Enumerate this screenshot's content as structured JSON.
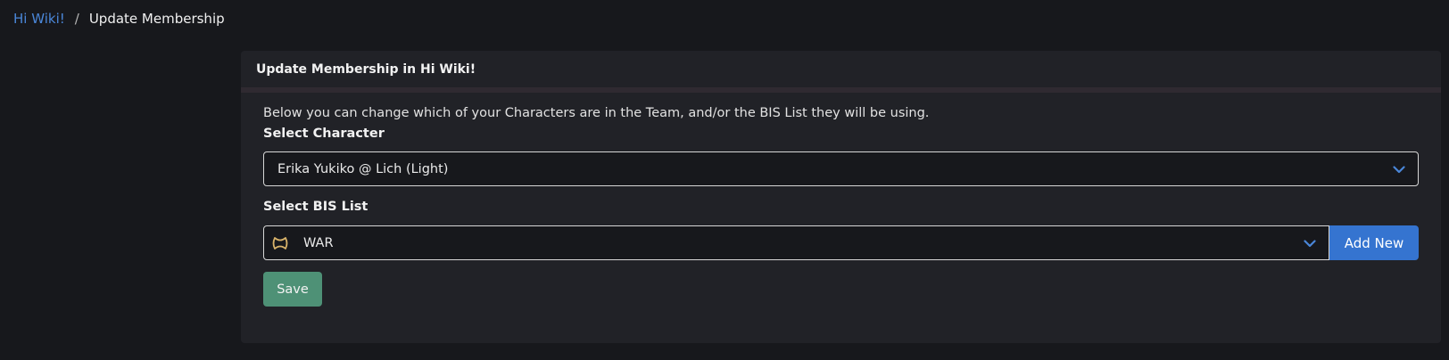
{
  "breadcrumb": {
    "team_link": "Hi Wiki!",
    "separator": "/",
    "current": "Update Membership"
  },
  "card": {
    "header_title": "Update Membership in Hi Wiki!",
    "intro": "Below you can change which of your Characters are in the Team, and/or the BIS List they will be using.",
    "character": {
      "label": "Select Character",
      "selected": "Erika Yukiko @ Lich (Light)"
    },
    "bis": {
      "label": "Select BIS List",
      "selected": "WAR",
      "job_icon": "warrior-job-icon",
      "add_new_label": "Add New"
    },
    "save_label": "Save"
  },
  "colors": {
    "accent_blue": "#3574d0",
    "link_blue": "#4a86d8",
    "save_green": "#4e9176",
    "job_icon_gold": "#d9b36a",
    "background": "#17181c",
    "card": "#212227"
  }
}
